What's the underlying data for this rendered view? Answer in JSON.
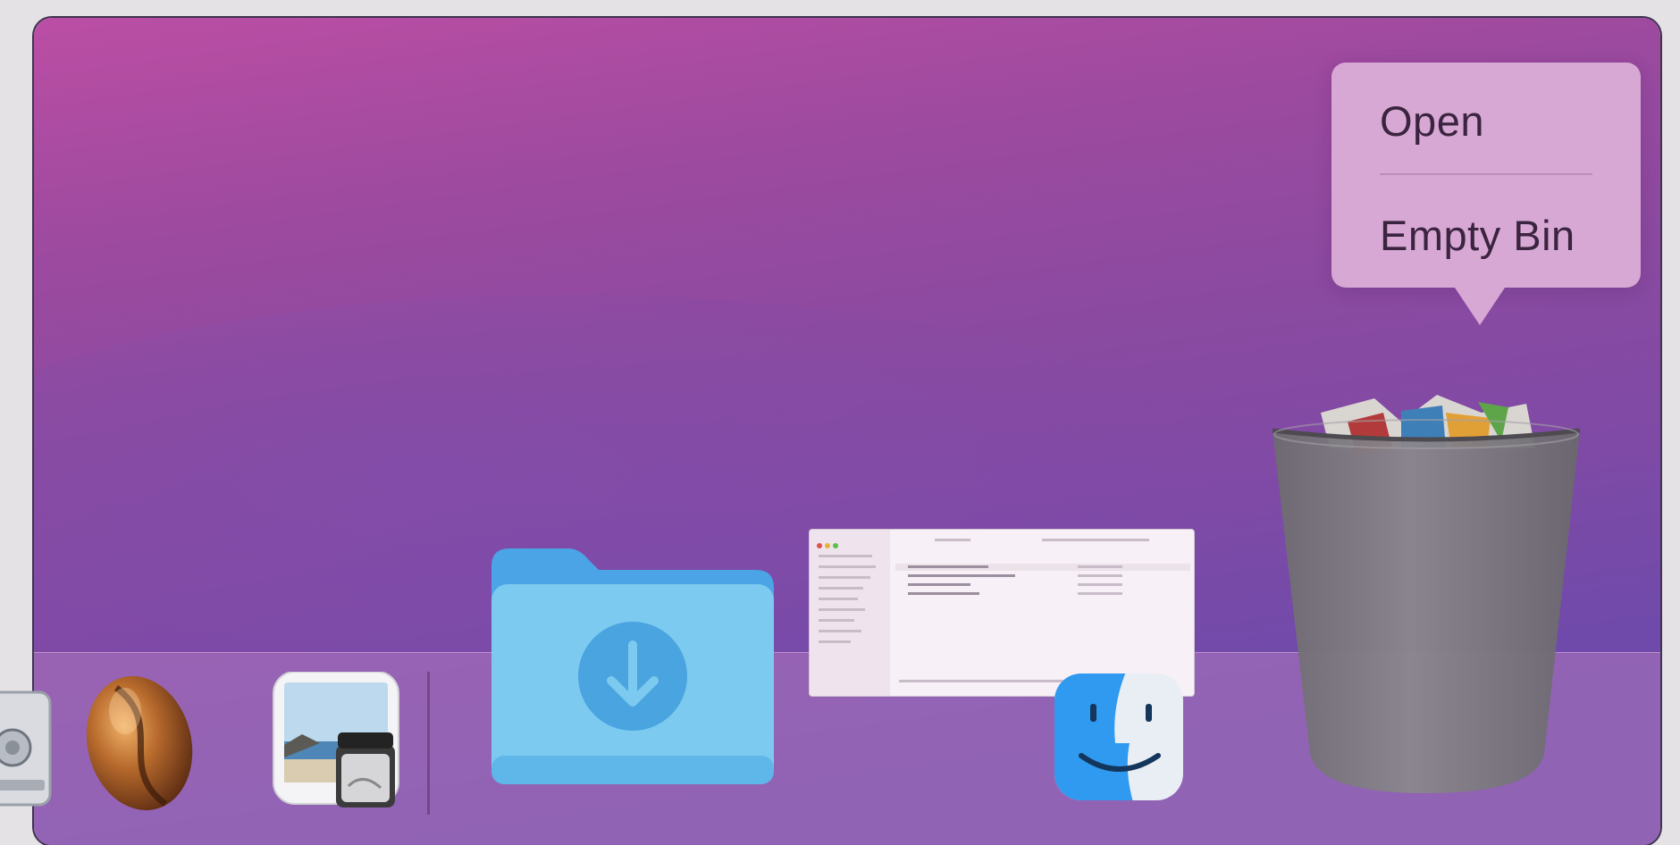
{
  "context_menu": {
    "open_label": "Open",
    "empty_bin_label": "Empty Bin"
  },
  "dock": {
    "items": [
      {
        "name": "app-partial",
        "icon": "lock-icon"
      },
      {
        "name": "coffee-app",
        "icon": "coffee-bean-icon"
      },
      {
        "name": "preview",
        "icon": "preview-icon"
      },
      {
        "name": "downloads",
        "icon": "downloads-folder-icon"
      },
      {
        "name": "finder-window-thumbnail",
        "icon": "finder-window-icon"
      },
      {
        "name": "finder",
        "icon": "finder-icon"
      },
      {
        "name": "bin",
        "icon": "trash-full-icon"
      }
    ]
  },
  "colors": {
    "wallpaper_top": "#bb4ea4",
    "wallpaper_bottom": "#6a49ac",
    "menu_bg": "#d8a8d4",
    "folder_blue": "#7ccaf0",
    "finder_blue": "#3ea2ee"
  }
}
